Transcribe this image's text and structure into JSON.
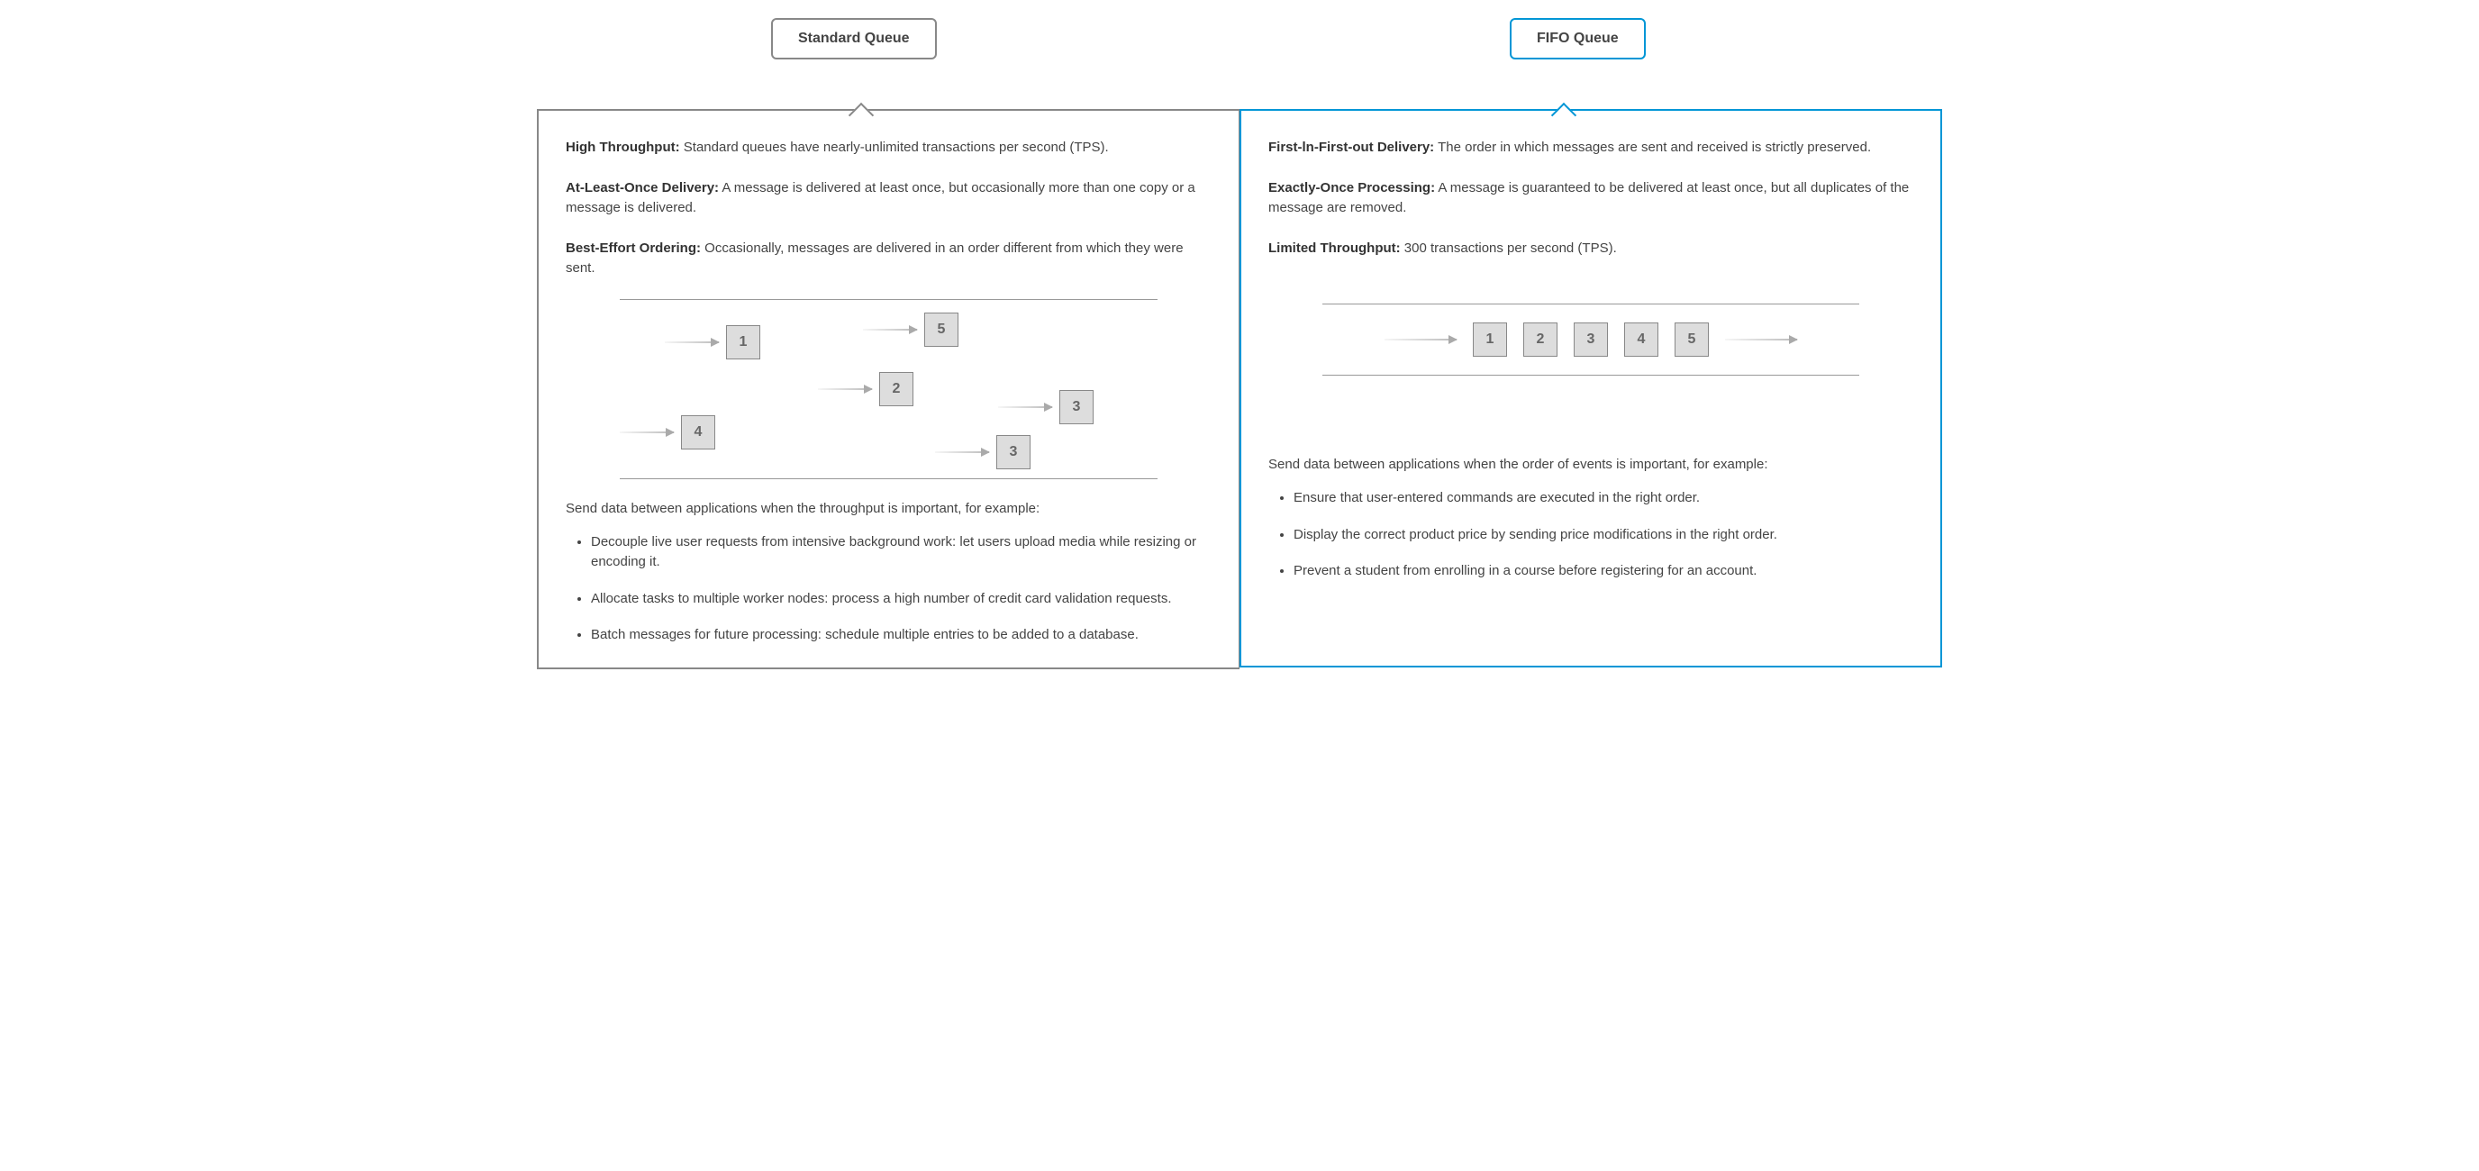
{
  "standard": {
    "tab": "Standard Queue",
    "features": [
      {
        "label": "High Throughput:",
        "text": " Standard queues have nearly-unlimited transactions per second (TPS)."
      },
      {
        "label": "At-Least-Once Delivery:",
        "text": " A message is delivered at least once, but occasionally more than one copy or a message is delivered."
      },
      {
        "label": "Best-Effort Ordering:",
        "text": " Occasionally, messages are delivered in an order different from which they were sent."
      }
    ],
    "diagram_messages": [
      "1",
      "5",
      "2",
      "3",
      "4",
      "3"
    ],
    "intro": "Send data between applications when the throughput is important, for example:",
    "examples": [
      "Decouple live user requests from intensive background work: let users upload media while resizing or encoding it.",
      "Allocate tasks to multiple worker nodes: process a high number of credit card validation requests.",
      "Batch messages for future processing: schedule multiple entries to be added to a database."
    ]
  },
  "fifo": {
    "tab": "FIFO Queue",
    "features": [
      {
        "label": "First-ln-First-out Delivery:",
        "text": " The order in which messages are sent and received is strictly preserved."
      },
      {
        "label": "Exactly-Once Processing:",
        "text": " A message is guaranteed to be delivered at least once, but all duplicates of the message are removed."
      },
      {
        "label": "Limited Throughput:",
        "text": " 300 transactions per second (TPS)."
      }
    ],
    "diagram_messages": [
      "1",
      "2",
      "3",
      "4",
      "5"
    ],
    "intro": "Send data between applications when the order of events is important, for example:",
    "examples": [
      "Ensure that user-entered commands are executed in the right order.",
      "Display the correct product price by sending price modifications in the right order.",
      "Prevent a student from enrolling in a course before registering for an account."
    ]
  }
}
